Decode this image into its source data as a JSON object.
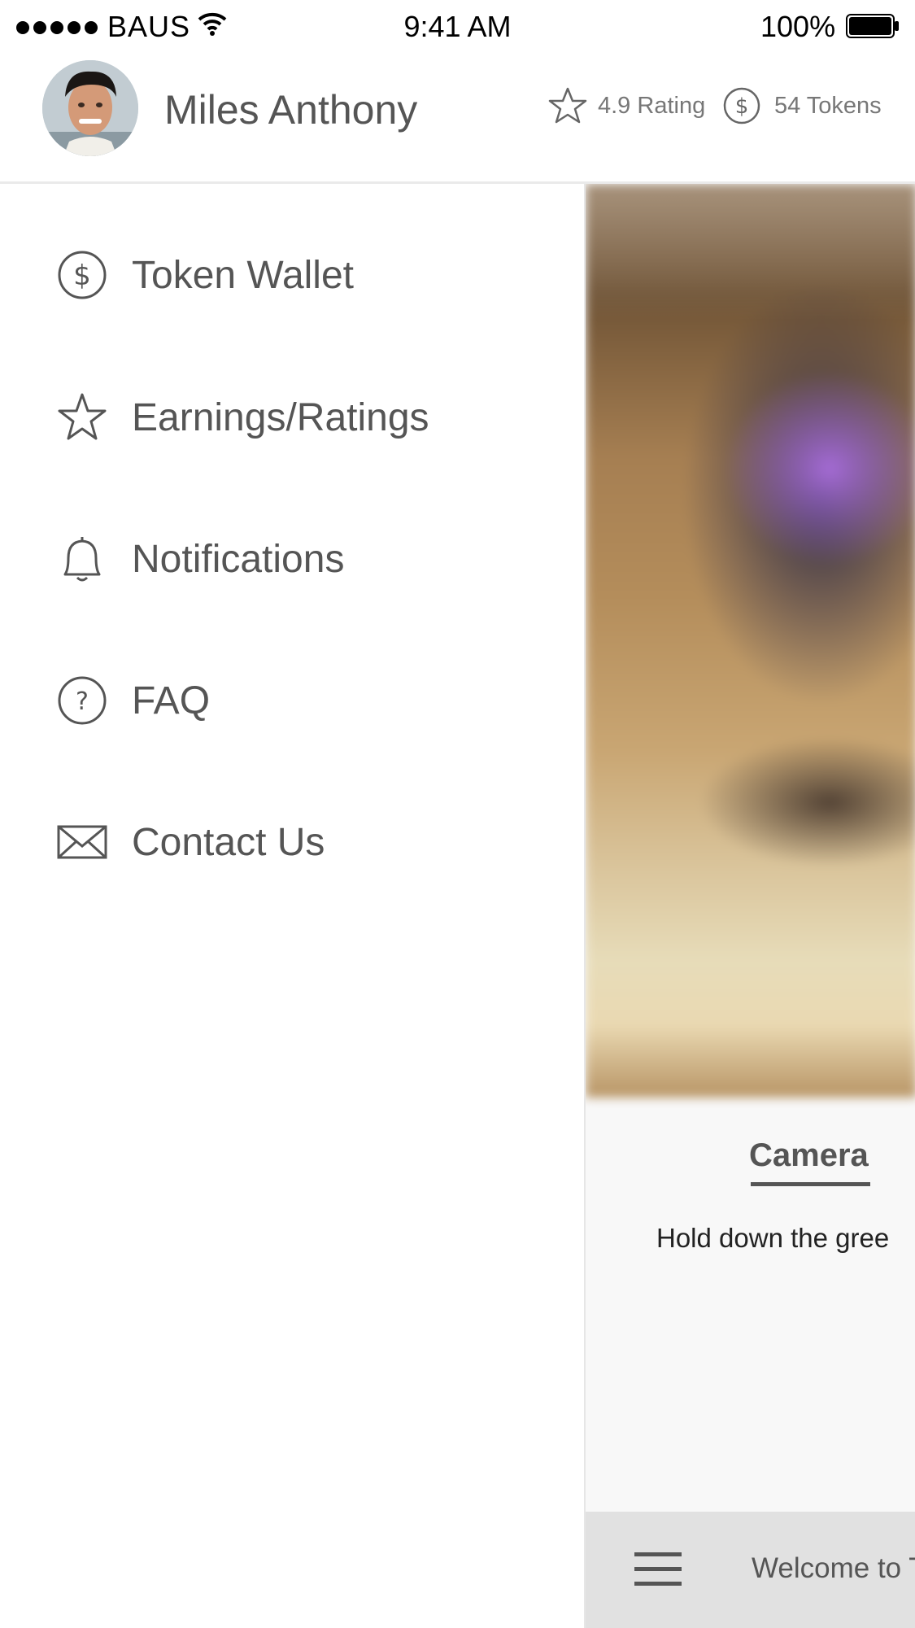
{
  "status_bar": {
    "carrier": "BAUS",
    "time": "9:41 AM",
    "battery": "100%"
  },
  "profile": {
    "name": "Miles Anthony",
    "rating": "4.9 Rating",
    "tokens": "54 Tokens"
  },
  "menu": {
    "items": [
      {
        "label": "Token Wallet",
        "icon": "dollar-circle-icon"
      },
      {
        "label": "Earnings/Ratings",
        "icon": "star-icon"
      },
      {
        "label": "Notifications",
        "icon": "bell-icon"
      },
      {
        "label": "FAQ",
        "icon": "question-circle-icon"
      },
      {
        "label": "Contact Us",
        "icon": "envelope-icon"
      }
    ]
  },
  "panel": {
    "title": "Camera",
    "description": "Hold down the gree",
    "welcome": "Welcome to T"
  },
  "colors": {
    "text": "#555555",
    "divider": "#eaeaea",
    "bottom_bar": "#e1e1e1",
    "panel_background": "#f8f8f8"
  }
}
